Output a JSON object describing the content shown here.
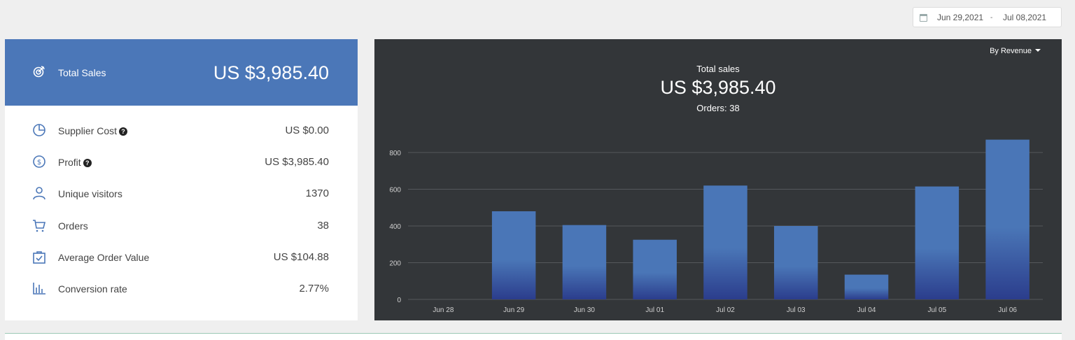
{
  "date_range": {
    "start": "Jun 29,2021",
    "separator": "-",
    "end": "Jul 08,2021"
  },
  "summary": {
    "total_sales_label": "Total Sales",
    "total_sales_value": "US $3,985.40",
    "metrics": [
      {
        "label": "Supplier Cost",
        "value": "US $0.00",
        "icon": "pie-chart-icon",
        "help": true
      },
      {
        "label": "Profit",
        "value": "US $3,985.40",
        "icon": "dollar-circle-icon",
        "help": true
      },
      {
        "label": "Unique visitors",
        "value": "1370",
        "icon": "user-icon",
        "help": false
      },
      {
        "label": "Orders",
        "value": "38",
        "icon": "cart-icon",
        "help": false
      },
      {
        "label": "Average Order Value",
        "value": "US $104.88",
        "icon": "shopping-bag-icon",
        "help": false
      },
      {
        "label": "Conversion rate",
        "value": "2.77%",
        "icon": "bar-chart-icon",
        "help": false
      }
    ]
  },
  "chart_panel": {
    "dropdown_label": "By Revenue",
    "title": "Total sales",
    "total": "US $3,985.40",
    "orders_text": "Orders: 38"
  },
  "colors": {
    "accent": "#4b77b8",
    "chart_bg": "#333639",
    "bar_top": "#4a76b7",
    "bar_bottom": "#2b3d8c"
  },
  "chart_data": {
    "type": "bar",
    "categories": [
      "Jun 28",
      "Jun 29",
      "Jun 30",
      "Jul 01",
      "Jul 02",
      "Jul 03",
      "Jul 04",
      "Jul 05",
      "Jul 06"
    ],
    "values": [
      0,
      480,
      405,
      325,
      620,
      400,
      135,
      615,
      870
    ],
    "ylim": [
      0,
      800
    ],
    "yticks": [
      0,
      200,
      400,
      600,
      800
    ],
    "grid": true,
    "xlabel": "",
    "ylabel": ""
  }
}
